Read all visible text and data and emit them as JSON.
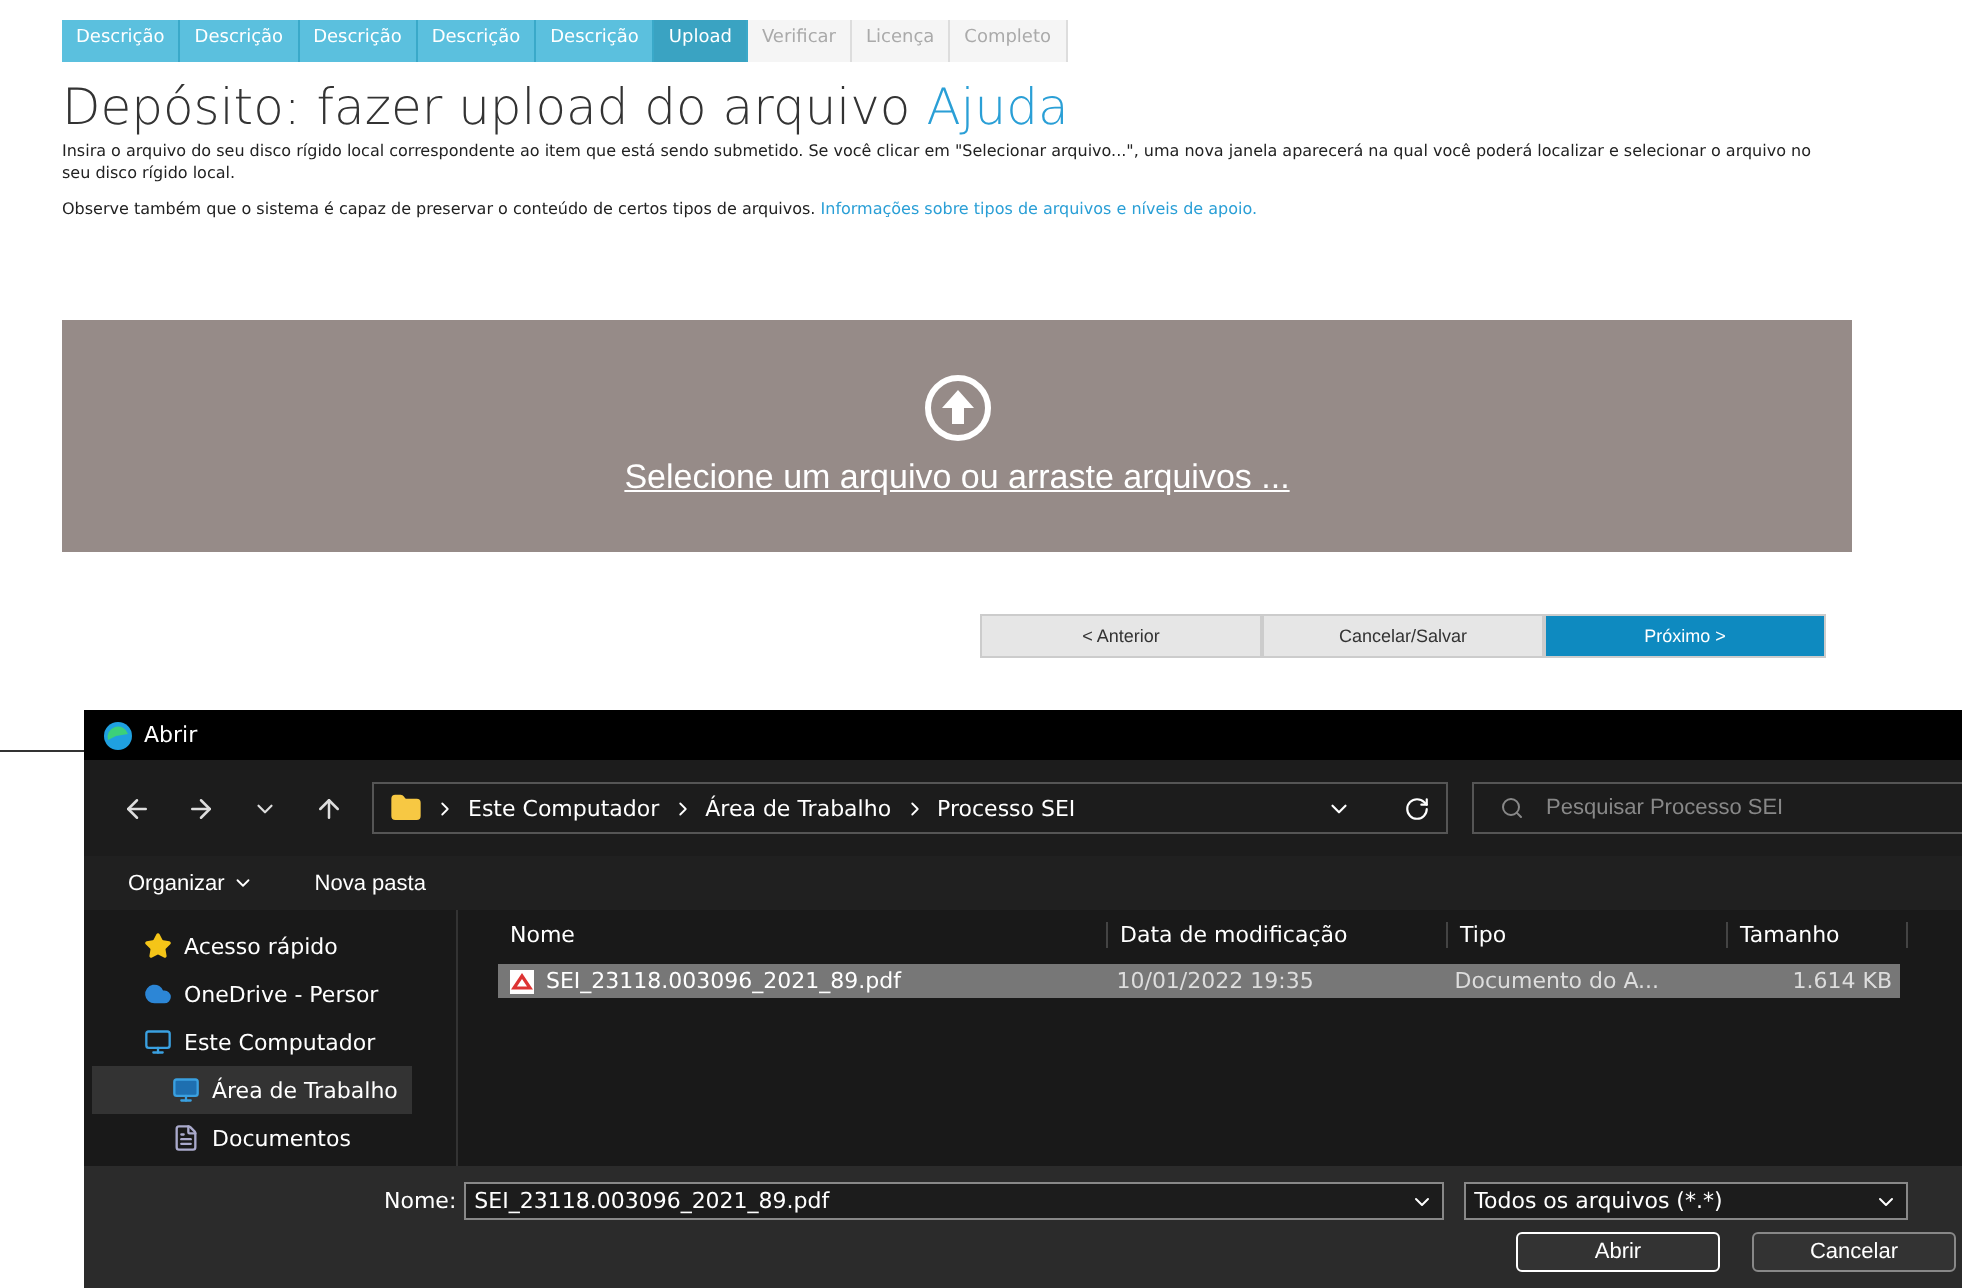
{
  "steps": [
    {
      "label": "Descrição",
      "done": true,
      "selected": false
    },
    {
      "label": "Descrição",
      "done": true,
      "selected": false
    },
    {
      "label": "Descrição",
      "done": true,
      "selected": false
    },
    {
      "label": "Descrição",
      "done": true,
      "selected": false
    },
    {
      "label": "Descrição",
      "done": true,
      "selected": false
    },
    {
      "label": "Upload",
      "done": true,
      "selected": true
    },
    {
      "label": "Verificar",
      "done": false,
      "selected": false
    },
    {
      "label": "Licença",
      "done": false,
      "selected": false
    },
    {
      "label": "Completo",
      "done": false,
      "selected": false
    }
  ],
  "heading": {
    "title": "Depósito: fazer upload do arquivo",
    "help_link": "Ajuda"
  },
  "intro": "Insira o arquivo do seu disco rígido local correspondente ao item que está sendo submetido. Se você clicar em \"Selecionar arquivo...\", uma nova janela aparecerá na qual você poderá localizar e selecionar o arquivo no seu disco rígido local.",
  "note": {
    "text": "Observe também que o sistema é capaz de preservar o conteúdo de certos tipos de arquivos.",
    "link": "Informações sobre tipos de arquivos e níveis de apoio."
  },
  "dropzone": {
    "label": "Selecione um arquivo ou arraste arquivos ..."
  },
  "nav_buttons": [
    {
      "label": "< Anterior",
      "primary": false
    },
    {
      "label": "Cancelar/Salvar",
      "primary": false
    },
    {
      "label": "Próximo >",
      "primary": true
    }
  ],
  "dialog": {
    "title": "Abrir",
    "path": [
      "Este Computador",
      "Área de Trabalho",
      "Processo SEI"
    ],
    "search": {
      "placeholder": "Pesquisar Processo SEI"
    },
    "toolbar": [
      "Organizar",
      "Nova pasta"
    ],
    "sidebar": [
      {
        "label": "Acesso rápido",
        "kind": "star",
        "selected": false
      },
      {
        "label": "OneDrive - Persor",
        "kind": "cloud",
        "selected": false
      },
      {
        "label": "Este Computador",
        "kind": "monitor",
        "selected": false,
        "children": [
          {
            "label": "Área de Trabalho",
            "kind": "desktop",
            "selected": true
          },
          {
            "label": "Documentos",
            "kind": "document",
            "selected": false
          }
        ]
      }
    ],
    "columns": [
      "Nome",
      "Data de modificação",
      "Tipo",
      "Tamanho"
    ],
    "files": [
      {
        "name": "SEI_23118.003096_2021_89.pdf",
        "modified": "10/01/2022 19:35",
        "type": "Documento do A...",
        "size": "1.614 KB",
        "selected": true
      }
    ],
    "filename_label": "Nome:",
    "filename": "SEI_23118.003096_2021_89.pdf",
    "filter": "Todos os arquivos (*.*)",
    "buttons": [
      {
        "label": "Abrir",
        "default": true
      },
      {
        "label": "Cancelar",
        "default": false
      }
    ]
  }
}
